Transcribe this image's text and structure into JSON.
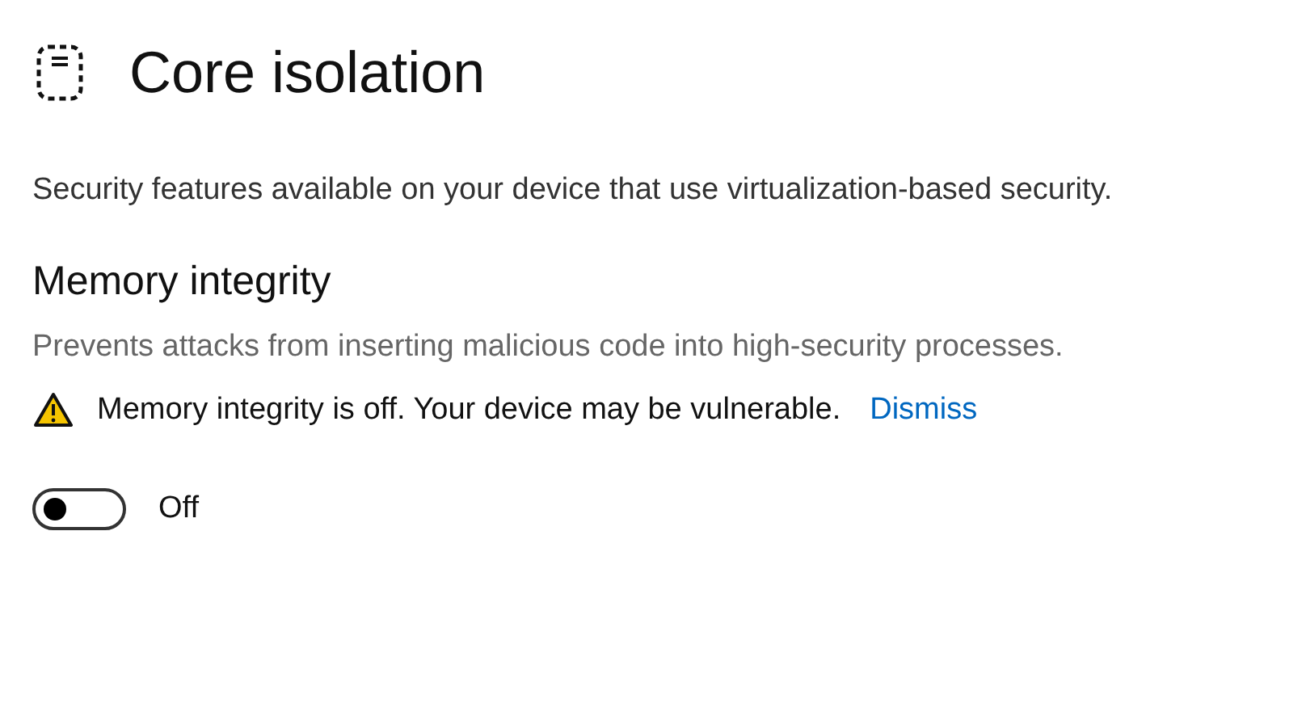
{
  "header": {
    "title": "Core isolation"
  },
  "description": "Security features available on your device that use virtualization-based security.",
  "section": {
    "title": "Memory integrity",
    "description": "Prevents attacks from inserting malicious code into high-security processes.",
    "warning": {
      "text": "Memory integrity is off. Your device may be vulnerable.",
      "link": "Dismiss"
    },
    "toggle": {
      "on": false,
      "label": "Off"
    }
  }
}
